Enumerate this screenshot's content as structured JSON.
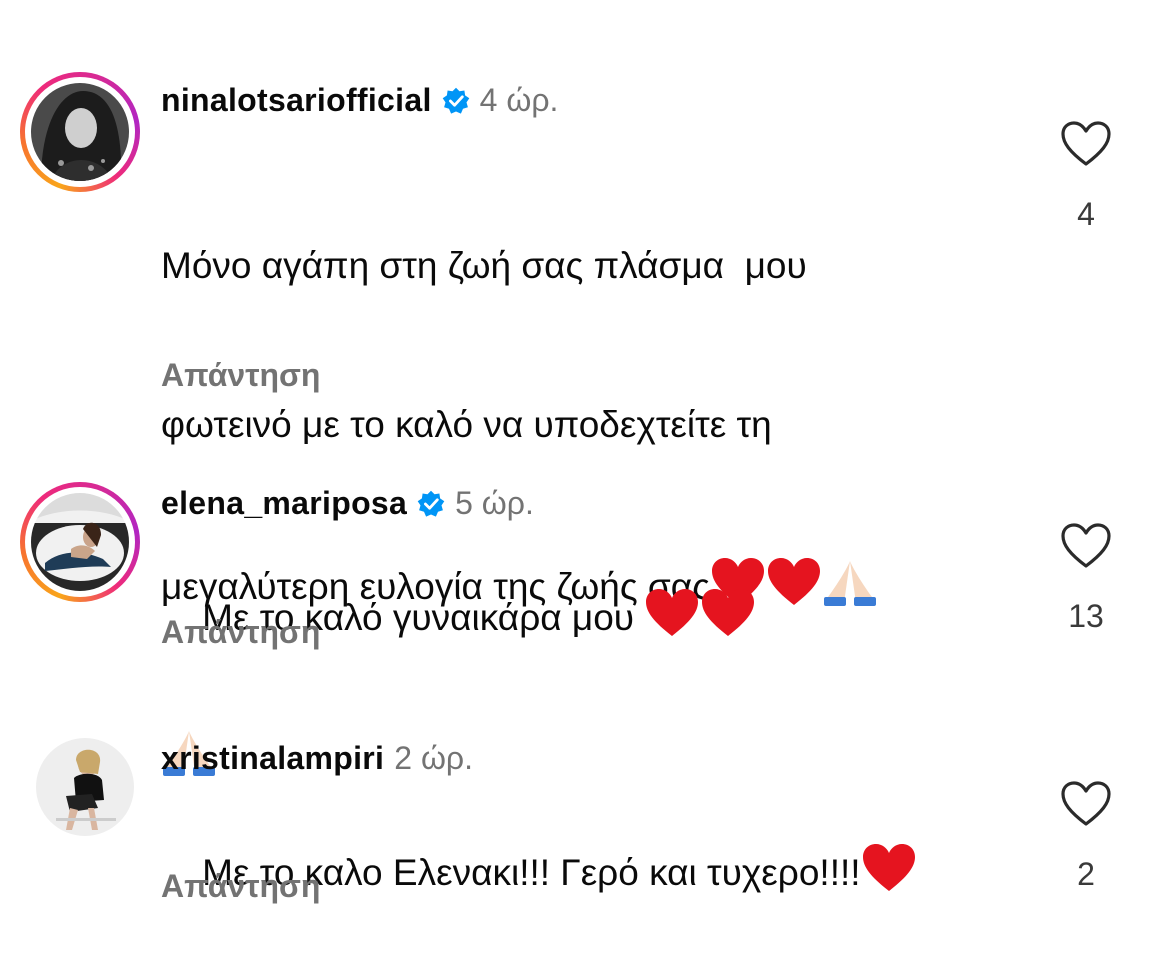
{
  "comments": [
    {
      "username": "ninalotsariofficial",
      "verified": true,
      "time": "4 ώρ.",
      "text_lines": [
        "Μόνο αγάπη στη ζωή σας πλάσμα  μου",
        "φωτεινό με το καλό να υποδεχτείτε τη",
        "μεγαλύτερη ευλογία της ζωής σας"
      ],
      "reply_label": "Απάντηση",
      "likes": "4",
      "story_ring": true
    },
    {
      "username": "elena_mariposa",
      "verified": true,
      "time": "5 ώρ.",
      "text": "Με το καλό γυναικάρα μου ",
      "reply_label": "Απάντηση",
      "likes": "13",
      "story_ring": true
    },
    {
      "username": "xristinalampiri",
      "verified": false,
      "time": "2 ώρ.",
      "text": "Με το καλο Ελενακι!!! Γερό και τυχερο!!!!",
      "reply_label": "Απάντηση",
      "likes": "2",
      "story_ring": false
    }
  ],
  "icons": {
    "verified_color": "#0095f6",
    "heart_emoji_color": "#e5141f",
    "like_icon": "heart-outline-icon"
  }
}
